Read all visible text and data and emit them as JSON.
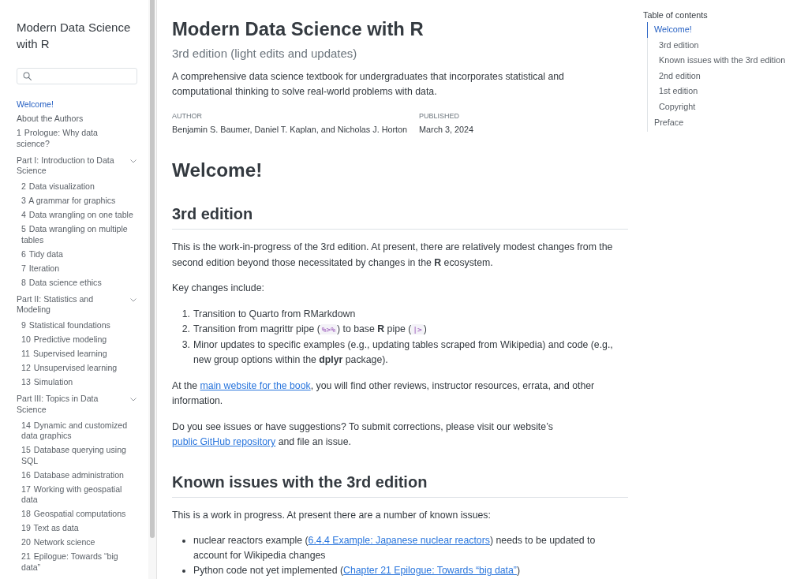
{
  "sidebar": {
    "title": "Modern Data Science with R",
    "items": [
      {
        "kind": "page",
        "title": "Welcome!",
        "selected": true
      },
      {
        "kind": "page",
        "title": "About the Authors",
        "selected": false
      },
      {
        "kind": "page",
        "number": "1",
        "title": "Prologue: Why data science?",
        "selected": false
      },
      {
        "kind": "part",
        "title": "Part I: Introduction to Data Science",
        "selected": false,
        "expanded": true,
        "children": [
          {
            "number": "2",
            "title": "Data visualization",
            "selected": false
          },
          {
            "number": "3",
            "title": "A grammar for graphics",
            "selected": false
          },
          {
            "number": "4",
            "title": "Data wrangling on one table",
            "selected": false
          },
          {
            "number": "5",
            "title": "Data wrangling on multiple tables",
            "selected": false
          },
          {
            "number": "6",
            "title": "Tidy data",
            "selected": false
          },
          {
            "number": "7",
            "title": "Iteration",
            "selected": false
          },
          {
            "number": "8",
            "title": "Data science ethics",
            "selected": false
          }
        ]
      },
      {
        "kind": "part",
        "title": "Part II: Statistics and Modeling",
        "selected": false,
        "expanded": true,
        "children": [
          {
            "number": "9",
            "title": "Statistical foundations",
            "selected": false
          },
          {
            "number": "10",
            "title": "Predictive modeling",
            "selected": false
          },
          {
            "number": "11",
            "title": "Supervised learning",
            "selected": false
          },
          {
            "number": "12",
            "title": "Unsupervised learning",
            "selected": false
          },
          {
            "number": "13",
            "title": "Simulation",
            "selected": false
          }
        ]
      },
      {
        "kind": "part",
        "title": "Part III: Topics in Data Science",
        "selected": false,
        "expanded": true,
        "children": [
          {
            "number": "14",
            "title": "Dynamic and customized data graphics",
            "selected": false
          },
          {
            "number": "15",
            "title": "Database querying using SQL",
            "selected": false
          },
          {
            "number": "16",
            "title": "Database administration",
            "selected": false
          },
          {
            "number": "17",
            "title": "Working with geospatial data",
            "selected": false
          },
          {
            "number": "18",
            "title": "Geospatial computations",
            "selected": false
          },
          {
            "number": "19",
            "title": "Text as data",
            "selected": false
          },
          {
            "number": "20",
            "title": "Network science",
            "selected": false
          },
          {
            "number": "21",
            "title": "Epilogue: Towards “big data”",
            "selected": false
          }
        ]
      }
    ]
  },
  "page": {
    "title": "Modern Data Science with R",
    "subtitle": "3rd edition (light edits and updates)",
    "description": "A comprehensive data science textbook for undergraduates that incorporates statistical and computational thinking to solve real-world problems with data.",
    "meta": [
      {
        "label": "AUTHOR",
        "value": "Benjamin S. Baumer, Daniel T. Kaplan, and Nicholas J. Horton"
      },
      {
        "label": "PUBLISHED",
        "value": "March 3, 2024"
      }
    ],
    "content": [
      {
        "kind": "heading1",
        "text": "Welcome!"
      },
      {
        "kind": "heading2",
        "text": "3rd edition"
      },
      {
        "kind": "paragraph",
        "segments": [
          {
            "kind": "text",
            "text": "This is the work-in-progress of the 3rd edition. At present, there are relatively modest changes from the second edition beyond those necessitated by changes in the **R** ecosystem."
          }
        ]
      },
      {
        "kind": "paragraph",
        "segments": [
          {
            "kind": "text",
            "text": "Key changes include:"
          }
        ]
      },
      {
        "kind": "numbered_list",
        "items": [
          {
            "number": "1.",
            "segments": [
              {
                "kind": "text",
                "text": "Transition to Quarto from RMarkdown"
              }
            ]
          },
          {
            "number": "2.",
            "segments": [
              {
                "kind": "text",
                "text": "Transition from magrittr pipe ("
              },
              {
                "kind": "code",
                "text": "%>%"
              },
              {
                "kind": "text",
                "text": ") to base **R** pipe ("
              },
              {
                "kind": "code",
                "text": "|>"
              },
              {
                "kind": "text",
                "text": ")"
              }
            ]
          },
          {
            "number": "3.",
            "segments": [
              {
                "kind": "text",
                "text": "Minor updates to specific examples (e.g., updating tables scraped from Wikipedia) and code (e.g., new group options within the **dplyr** package)."
              }
            ]
          }
        ]
      },
      {
        "kind": "paragraph",
        "segments": [
          {
            "kind": "text",
            "text": "At the "
          },
          {
            "kind": "link",
            "text": "main website for the book"
          },
          {
            "kind": "text",
            "text": ", you will find other reviews, instructor resources, errata, and other information."
          }
        ]
      },
      {
        "kind": "paragraph",
        "segments": [
          {
            "kind": "text",
            "text": "Do you see issues or have suggestions? To submit corrections, please visit our website’s "
          },
          {
            "kind": "link",
            "text": "public GitHub repository"
          },
          {
            "kind": "text",
            "text": " and file an issue."
          }
        ]
      },
      {
        "kind": "heading2",
        "text": "Known issues with the 3rd edition"
      },
      {
        "kind": "paragraph",
        "segments": [
          {
            "kind": "text",
            "text": "This is a work in progress. At present there are a number of known issues:"
          }
        ]
      },
      {
        "kind": "bullet_list",
        "items": [
          {
            "segments": [
              {
                "kind": "text",
                "text": "nuclear reactors example ("
              },
              {
                "kind": "link",
                "text": "6.4.4 Example: Japanese nuclear reactors"
              },
              {
                "kind": "text",
                "text": ") needs to be updated to account for Wikipedia changes"
              }
            ]
          },
          {
            "segments": [
              {
                "kind": "text",
                "text": "Python code not yet implemented ("
              },
              {
                "kind": "link",
                "text": "Chapter 21 Epilogue: Towards “big data”"
              },
              {
                "kind": "text",
                "text": ")"
              }
            ]
          }
        ]
      }
    ]
  },
  "toc": {
    "title": "Table of contents",
    "items": [
      {
        "label": "Welcome!",
        "selected": true,
        "children": [
          {
            "label": "3rd edition",
            "selected": false
          },
          {
            "label": "Known issues with the 3rd edition",
            "selected": false
          },
          {
            "label": "2nd edition",
            "selected": false
          },
          {
            "label": "1st edition",
            "selected": false
          },
          {
            "label": "Copyright",
            "selected": false
          }
        ]
      },
      {
        "label": "Preface",
        "selected": false
      }
    ]
  }
}
